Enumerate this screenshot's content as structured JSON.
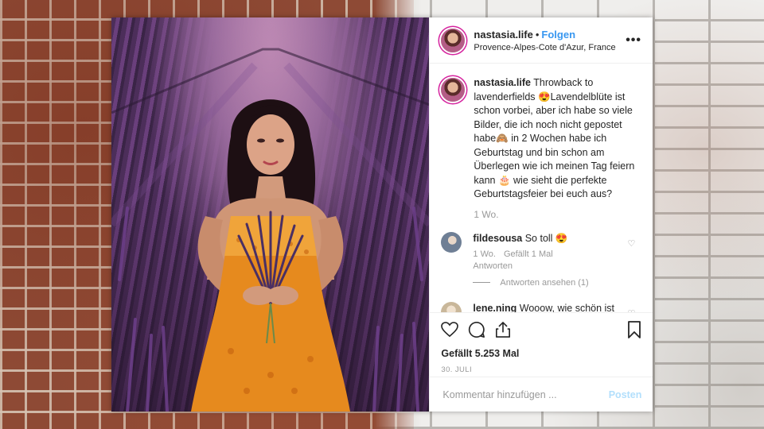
{
  "post": {
    "username": "nastasia.life",
    "separator": "•",
    "follow_label": "Folgen",
    "location": "Provence-Alpes-Cote d'Azur, France",
    "more_label": "•••",
    "caption_username": "nastasia.life",
    "caption_text": "Throwback to lavenderfields 😍Lavendelblüte ist schon vorbei, aber ich habe so viele Bilder, die ich noch nicht gepostet habe🙈 in 2 Wochen habe ich Geburtstag und bin schon am Überlegen wie ich meinen Tag feiern kann 🎂 wie sieht die perfekte Geburtstagsfeier bei euch aus?",
    "caption_time": "1 Wo.",
    "likes": "Gefällt 5.253 Mal",
    "date": "30. JULI",
    "comment_placeholder": "Kommentar hinzufügen ...",
    "post_button": "Posten"
  },
  "comments": [
    {
      "username": "fildesousa",
      "text": "So toll 😍",
      "time": "1 Wo.",
      "likes": "Gefällt 1 Mal",
      "reply": "Antworten",
      "view_replies": "Antworten ansehen (1)",
      "avatar_color": "#6f7f95"
    },
    {
      "username": "lene.ning",
      "text": "Wooow, wie schön ist das Bild denn bitte 😍💜💜",
      "avatar_color": "#c9b79a"
    }
  ],
  "icons": {
    "like": "heart-icon",
    "comment": "comment-icon",
    "share": "share-icon",
    "save": "bookmark-icon",
    "more": "more-icon",
    "comment_like": "heart-icon"
  },
  "colors": {
    "link": "#3897f0",
    "post_disabled": "#b2dffc",
    "text": "#262626",
    "muted": "#999999"
  }
}
